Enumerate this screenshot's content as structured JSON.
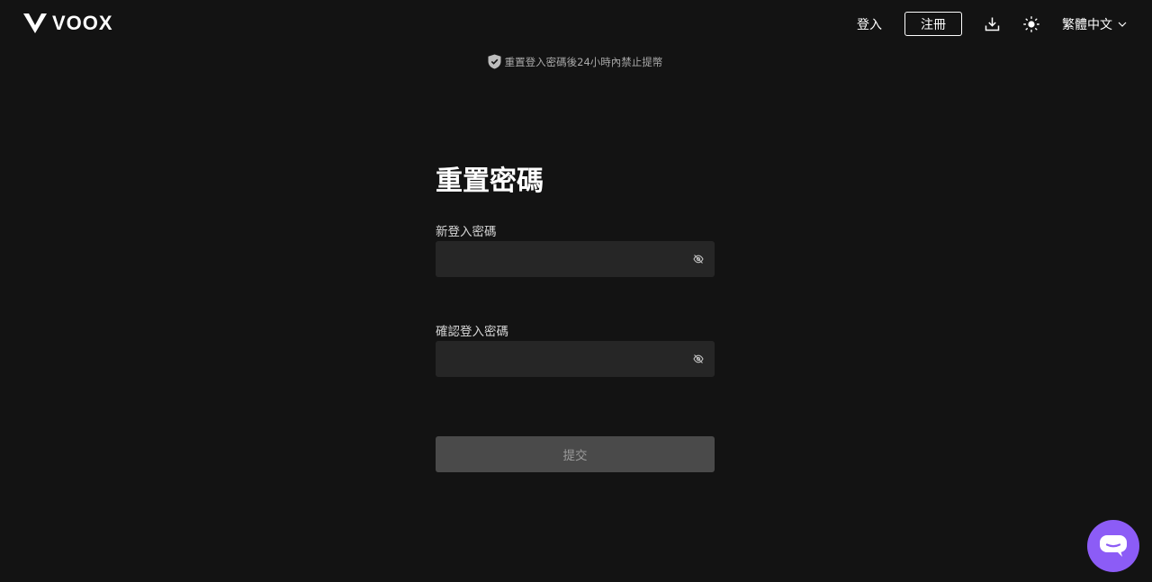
{
  "header": {
    "brand": "VOOX",
    "login": "登入",
    "register": "注冊",
    "language": "繁體中文",
    "icons": {
      "logo": "voox-logo-icon",
      "download": "download-icon",
      "theme": "sun-icon",
      "language_caret": "chevron-down-icon"
    }
  },
  "notice": {
    "text": "重置登入密碼後24小時內禁止提幣",
    "icon": "shield-check-icon"
  },
  "form": {
    "title": "重置密碼",
    "new_password": {
      "label": "新登入密碼",
      "value": "",
      "placeholder": ""
    },
    "confirm_password": {
      "label": "確認登入密碼",
      "value": "",
      "placeholder": ""
    },
    "eye_icon": "eye-off-icon",
    "submit": "提交"
  },
  "chat": {
    "icon": "chat-bubble-icon"
  },
  "colors": {
    "background": "#131313",
    "input": "#262626",
    "button_disabled": "#4a4a4a",
    "chat_accent": "#8c5cf6"
  }
}
